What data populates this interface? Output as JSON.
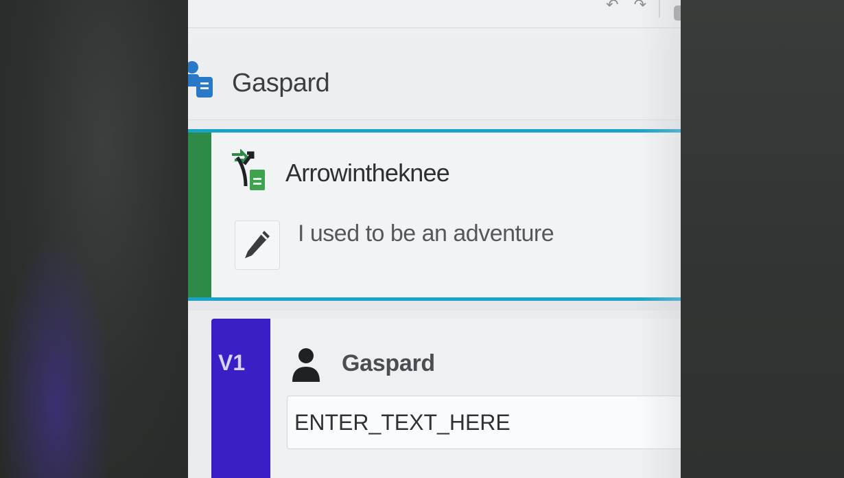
{
  "header": {
    "name": "Gaspard"
  },
  "card": {
    "title": "Arrowintheknee",
    "message": "I used to be an adventure",
    "accent_color": "#1aa3c9",
    "stripe_color": "#2e8b47"
  },
  "version_row": {
    "badge": "V1",
    "badge_color": "#3a1fc7",
    "user_name": "Gaspard",
    "input_value": "ENTER_TEXT_HERE"
  },
  "icons": {
    "toolbar": [
      "undo-icon",
      "redo-icon"
    ],
    "header": "users-icon",
    "card": "merge-icon",
    "edit": "pencil-icon",
    "user": "person-icon"
  }
}
